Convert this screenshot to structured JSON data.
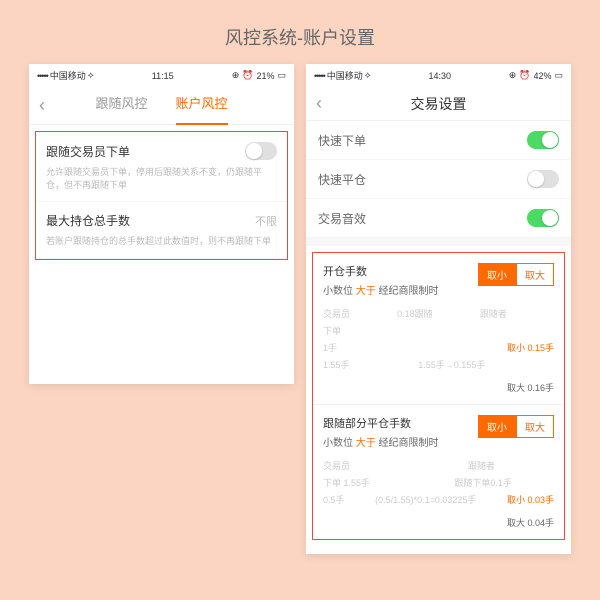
{
  "pageTitle": "风控系统-账户设置",
  "left": {
    "status": {
      "carrier": "中国移动",
      "time": "11:15",
      "battery": "21%"
    },
    "tabs": {
      "follow": "跟随风控",
      "account": "账户风控"
    },
    "row1": {
      "label": "跟随交易员下单",
      "desc": "允许跟随交易员下单，停用后跟随关系不变，仍跟随平仓，但不再跟随下单"
    },
    "row2": {
      "label": "最大持仓总手数",
      "value": "不限",
      "desc": "若账户跟随持仓的总手数超过此数值时，则不再跟随下单"
    }
  },
  "right": {
    "status": {
      "carrier": "中国移动",
      "time": "14:30",
      "battery": "42%"
    },
    "title": "交易设置",
    "quick": {
      "order": "快速下单",
      "close": "快速平仓",
      "sound": "交易音效"
    },
    "sec1": {
      "title": "开仓手数",
      "sub1": "小数位 ",
      "greater": "大于",
      "sub2": " 经纪商限制时",
      "seg": {
        "small": "取小",
        "big": "取大"
      },
      "ex": {
        "c1": "交易员",
        "c2": "跟随者",
        "c1v": "下单",
        "r1": "0.18跟随",
        "v1": "1手",
        "v2": "1.55手→0.155手",
        "hl": "取小 0.15手",
        "foot": "取大 0.16手",
        "v0": "1.55手"
      }
    },
    "sec2": {
      "title": "跟随部分平仓手数",
      "sub1": "小数位 ",
      "greater": "大于",
      "sub2": " 经纪商限制时",
      "seg": {
        "small": "取小",
        "big": "取大"
      },
      "ex": {
        "c1": "交易员",
        "c2": "跟随者",
        "d1": "下单 1.55手",
        "d2": "跟随下单0.1手",
        "v1": "0.5手",
        "v2": "(0.5/1.55)*0.1=0.03225手",
        "hl": "取小 0.03手",
        "foot": "取大 0.04手"
      }
    }
  }
}
